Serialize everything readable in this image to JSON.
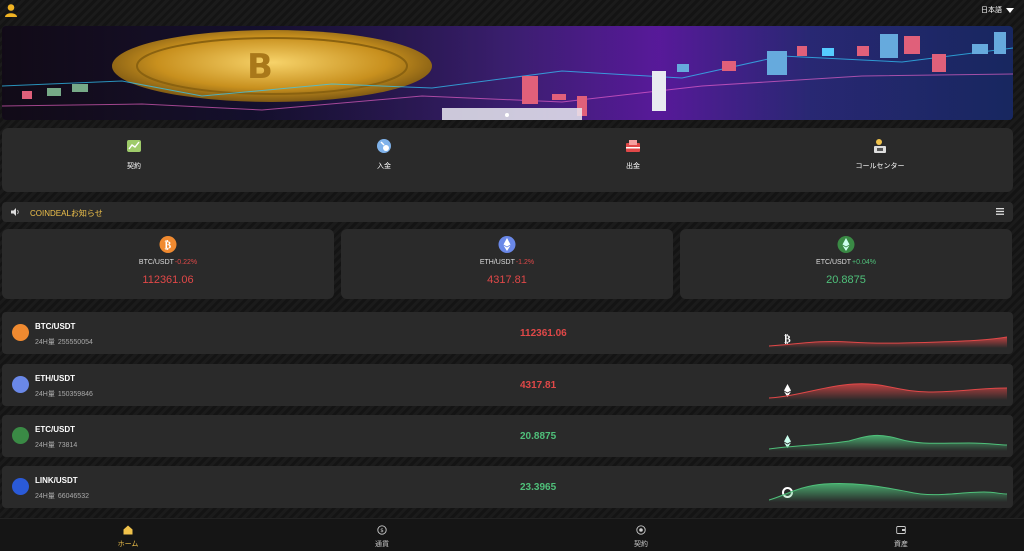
{
  "header": {
    "language": "日本語"
  },
  "quick_actions": [
    {
      "label": "契約",
      "icon": "chart-icon"
    },
    {
      "label": "入金",
      "icon": "deposit-icon"
    },
    {
      "label": "出金",
      "icon": "withdraw-icon"
    },
    {
      "label": "コールセンター",
      "icon": "support-icon"
    }
  ],
  "notice": {
    "text": "COINDEALお知らせ"
  },
  "tickers": [
    {
      "pair": "BTC/USDT",
      "change": "-0.22%",
      "price": "112361.06",
      "trend": "down"
    },
    {
      "pair": "ETH/USDT",
      "change": "-1.2%",
      "price": "4317.81",
      "trend": "down"
    },
    {
      "pair": "ETC/USDT",
      "change": "+0.04%",
      "price": "20.8875",
      "trend": "up"
    }
  ],
  "market": [
    {
      "pair": "BTC/USDT",
      "vol_label": "24H量",
      "volume": "255550054",
      "price": "112361.06",
      "trend": "down"
    },
    {
      "pair": "ETH/USDT",
      "vol_label": "24H量",
      "volume": "150359846",
      "price": "4317.81",
      "trend": "down"
    },
    {
      "pair": "ETC/USDT",
      "vol_label": "24H量",
      "volume": "73814",
      "price": "20.8875",
      "trend": "up"
    },
    {
      "pair": "LINK/USDT",
      "vol_label": "24H量",
      "volume": "66046532",
      "price": "23.3965",
      "trend": "up"
    }
  ],
  "bottom_nav": [
    {
      "label": "ホーム",
      "icon": "home-icon",
      "active": true
    },
    {
      "label": "通貨",
      "icon": "currency-icon",
      "active": false
    },
    {
      "label": "契約",
      "icon": "contract-icon",
      "active": false
    },
    {
      "label": "資産",
      "icon": "wallet-icon",
      "active": false
    }
  ],
  "colors": {
    "accent": "#f0c24b",
    "down": "#e04848",
    "up": "#4fc07a",
    "card": "#2a2a2a"
  }
}
